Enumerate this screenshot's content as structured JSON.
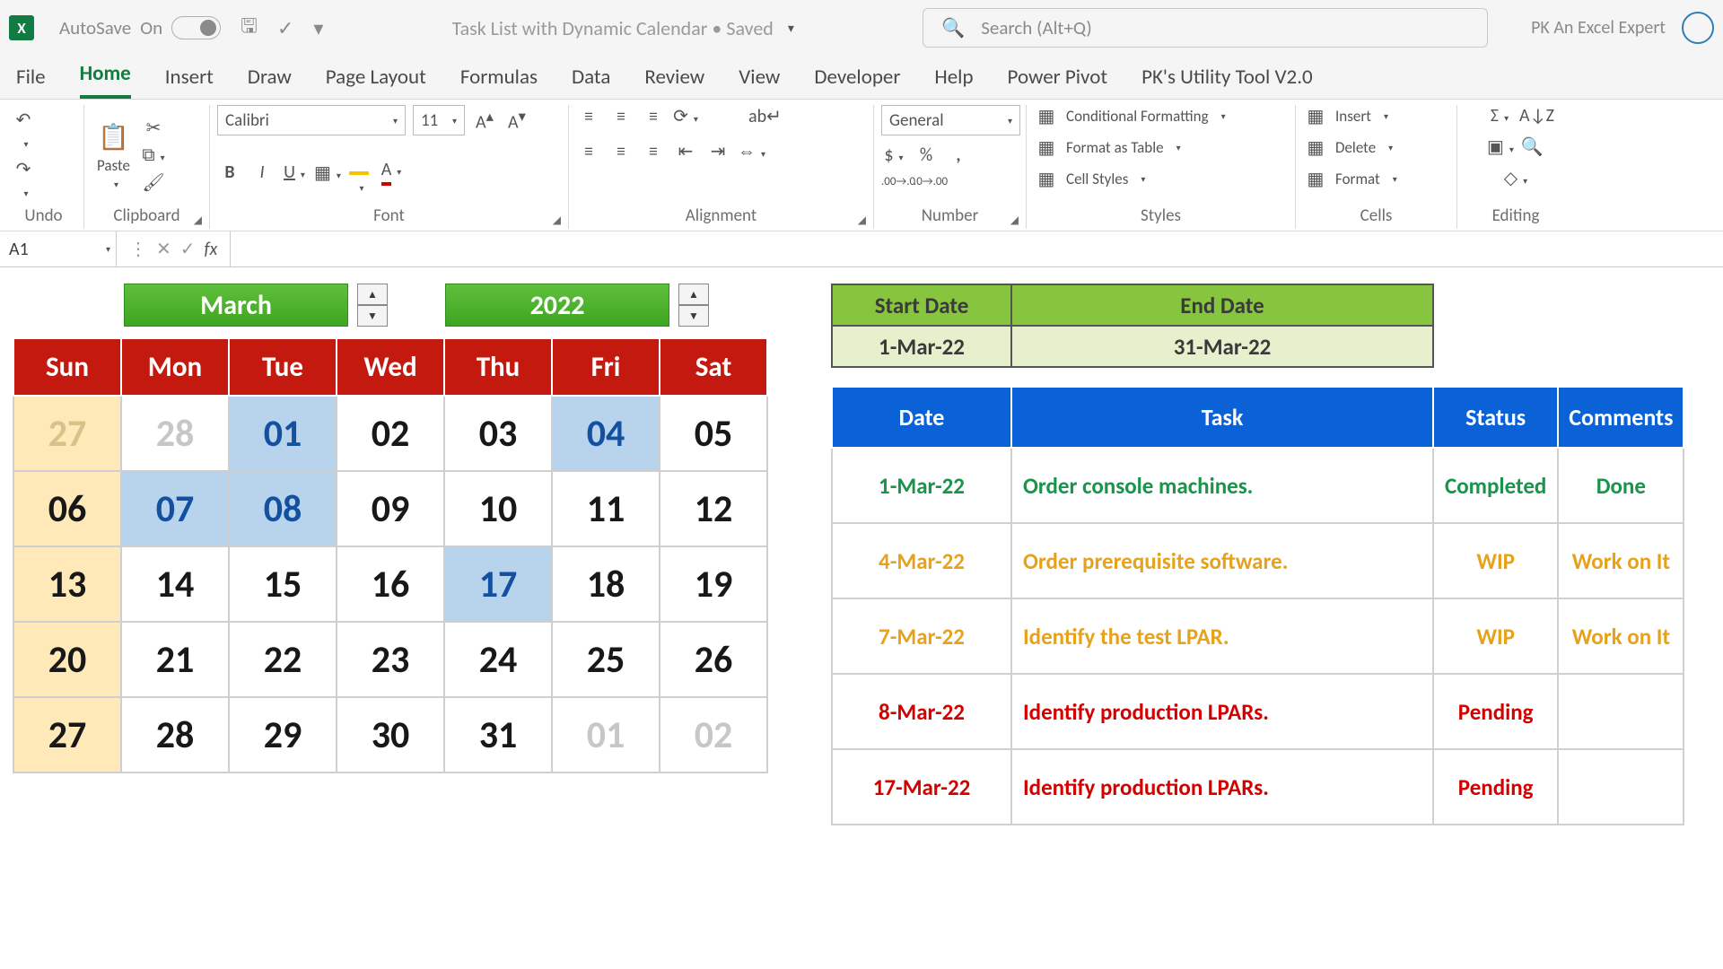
{
  "titlebar": {
    "autosave_label": "AutoSave",
    "autosave_state": "On",
    "document_name": "Task List with Dynamic Calendar • Saved",
    "search_placeholder": "Search (Alt+Q)",
    "user_name": "PK An Excel Expert"
  },
  "tabs": {
    "items": [
      "File",
      "Home",
      "Insert",
      "Draw",
      "Page Layout",
      "Formulas",
      "Data",
      "Review",
      "View",
      "Developer",
      "Help",
      "Power Pivot",
      "PK's Utility Tool V2.0"
    ],
    "active": "Home"
  },
  "ribbon": {
    "undo": "Undo",
    "clipboard": {
      "label": "Clipboard",
      "paste": "Paste"
    },
    "font": {
      "label": "Font",
      "name": "Calibri",
      "size": "11"
    },
    "alignment": {
      "label": "Alignment"
    },
    "number": {
      "label": "Number",
      "format": "General"
    },
    "styles": {
      "label": "Styles",
      "cond": "Conditional Formatting",
      "table": "Format as Table",
      "cell": "Cell Styles"
    },
    "cells": {
      "label": "Cells",
      "insert": "Insert",
      "delete": "Delete",
      "format": "Format"
    },
    "editing": {
      "label": "Editing"
    }
  },
  "formula_bar": {
    "cell_ref": "A1",
    "formula": ""
  },
  "calendar": {
    "month": "March",
    "year": "2022",
    "day_headers": [
      "Sun",
      "Mon",
      "Tue",
      "Wed",
      "Thu",
      "Fri",
      "Sat"
    ],
    "grid": [
      [
        {
          "d": "27",
          "cls": "deadsun"
        },
        {
          "d": "28",
          "cls": "dead"
        },
        {
          "d": "01",
          "cls": "hl"
        },
        {
          "d": "02"
        },
        {
          "d": "03"
        },
        {
          "d": "04",
          "cls": "hl"
        },
        {
          "d": "05"
        }
      ],
      [
        {
          "d": "06",
          "cls": "sun"
        },
        {
          "d": "07",
          "cls": "hl"
        },
        {
          "d": "08",
          "cls": "hl"
        },
        {
          "d": "09"
        },
        {
          "d": "10"
        },
        {
          "d": "11"
        },
        {
          "d": "12"
        }
      ],
      [
        {
          "d": "13",
          "cls": "sun"
        },
        {
          "d": "14"
        },
        {
          "d": "15"
        },
        {
          "d": "16"
        },
        {
          "d": "17",
          "cls": "hl"
        },
        {
          "d": "18"
        },
        {
          "d": "19"
        }
      ],
      [
        {
          "d": "20",
          "cls": "sun"
        },
        {
          "d": "21"
        },
        {
          "d": "22"
        },
        {
          "d": "23"
        },
        {
          "d": "24"
        },
        {
          "d": "25"
        },
        {
          "d": "26"
        }
      ],
      [
        {
          "d": "27",
          "cls": "sun"
        },
        {
          "d": "28"
        },
        {
          "d": "29"
        },
        {
          "d": "30"
        },
        {
          "d": "31"
        },
        {
          "d": "01",
          "cls": "dead"
        },
        {
          "d": "02",
          "cls": "dead"
        }
      ]
    ]
  },
  "range": {
    "start_h": "Start Date",
    "end_h": "End Date",
    "start": "1-Mar-22",
    "end": "31-Mar-22"
  },
  "tasks": {
    "headers": [
      "Date",
      "Task",
      "Status",
      "Comments"
    ],
    "rows": [
      {
        "date": "1-Mar-22",
        "task": "Order console machines.",
        "status": "Completed",
        "comments": "Done",
        "cls": "c-green"
      },
      {
        "date": "4-Mar-22",
        "task": "Order prerequisite software.",
        "status": "WIP",
        "comments": "Work on It",
        "cls": "c-amber"
      },
      {
        "date": "7-Mar-22",
        "task": "Identify the test LPAR.",
        "status": "WIP",
        "comments": "Work on It",
        "cls": "c-amber"
      },
      {
        "date": "8-Mar-22",
        "task": "Identify production LPARs.",
        "status": "Pending",
        "comments": "",
        "cls": "c-red"
      },
      {
        "date": "17-Mar-22",
        "task": "Identify production LPARs.",
        "status": "Pending",
        "comments": "",
        "cls": "c-red"
      }
    ]
  }
}
